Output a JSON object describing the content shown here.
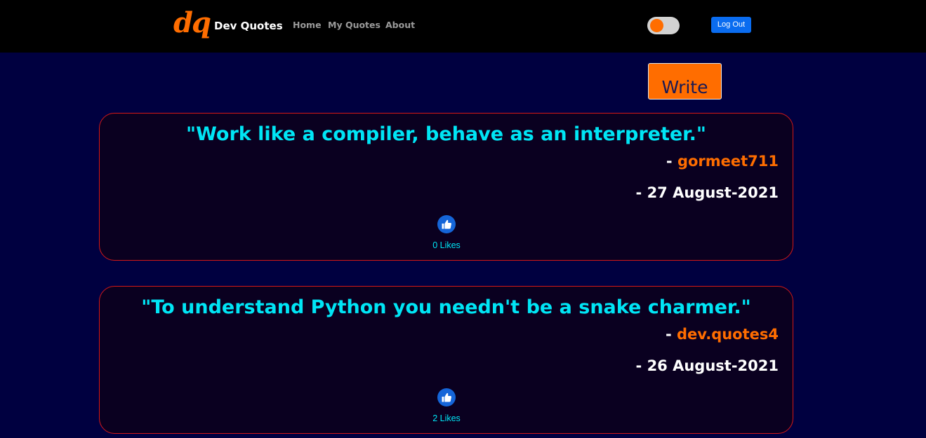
{
  "brand": {
    "logo": "dq",
    "name": "Dev Quotes"
  },
  "nav": {
    "home": "Home",
    "my_quotes": "My Quotes",
    "about": "About"
  },
  "header": {
    "logout_label": "Log Out"
  },
  "actions": {
    "write_label": "Write"
  },
  "colors": {
    "accent": "#ff6d00",
    "quote_text": "#00e5f5",
    "card_border": "#d41818",
    "background": "#000040",
    "logout_button": "#0a6cf0",
    "like_icon": "#1565d8"
  },
  "quotes": [
    {
      "text": "\"Work like a compiler, behave as an interpreter.\"",
      "author_prefix": "- ",
      "author": "gormeet711",
      "date": "- 27 August-2021",
      "likes": "0 Likes"
    },
    {
      "text": "\"To understand Python you needn't be a snake charmer.\"",
      "author_prefix": "- ",
      "author": "dev.quotes4",
      "date": "- 26 August-2021",
      "likes": "2 Likes"
    }
  ]
}
